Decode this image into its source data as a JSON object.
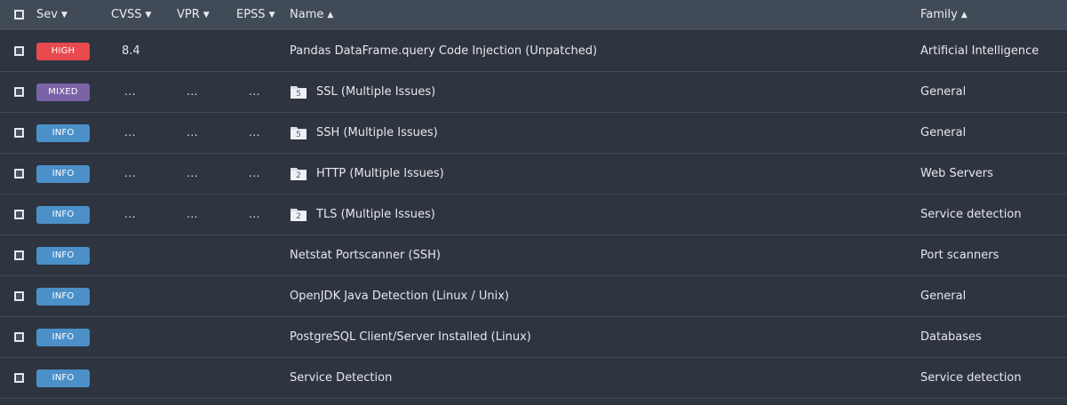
{
  "colors": {
    "high": "#e84a4f",
    "mixed": "#7a63a6",
    "info": "#4b90c9",
    "header_bg": "#414b58",
    "row_bg": "#2e3440"
  },
  "header": {
    "sev": "Sev",
    "cvss": "CVSS",
    "vpr": "VPR",
    "epss": "EPSS",
    "name": "Name",
    "family": "Family",
    "sort_down_icon": "caret-down-icon",
    "sort_up_icon": "caret-up-icon"
  },
  "rows": [
    {
      "severity": "HIGH",
      "sev_color": "high",
      "cvss": "8.4",
      "vpr": "",
      "epss": "",
      "has_folder": false,
      "count": "",
      "name": "Pandas DataFrame.query Code Injection (Unpatched)",
      "family": "Artificial Intelligence"
    },
    {
      "severity": "MIXED",
      "sev_color": "mixed",
      "cvss": "...",
      "vpr": "...",
      "epss": "...",
      "has_folder": true,
      "count": "5",
      "name": "SSL (Multiple Issues)",
      "family": "General"
    },
    {
      "severity": "INFO",
      "sev_color": "info",
      "cvss": "...",
      "vpr": "...",
      "epss": "...",
      "has_folder": true,
      "count": "5",
      "name": "SSH (Multiple Issues)",
      "family": "General"
    },
    {
      "severity": "INFO",
      "sev_color": "info",
      "cvss": "...",
      "vpr": "...",
      "epss": "...",
      "has_folder": true,
      "count": "2",
      "name": "HTTP (Multiple Issues)",
      "family": "Web Servers"
    },
    {
      "severity": "INFO",
      "sev_color": "info",
      "cvss": "...",
      "vpr": "...",
      "epss": "...",
      "has_folder": true,
      "count": "2",
      "name": "TLS (Multiple Issues)",
      "family": "Service detection"
    },
    {
      "severity": "INFO",
      "sev_color": "info",
      "cvss": "",
      "vpr": "",
      "epss": "",
      "has_folder": false,
      "count": "",
      "name": "Netstat Portscanner (SSH)",
      "family": "Port scanners"
    },
    {
      "severity": "INFO",
      "sev_color": "info",
      "cvss": "",
      "vpr": "",
      "epss": "",
      "has_folder": false,
      "count": "",
      "name": "OpenJDK Java Detection (Linux / Unix)",
      "family": "General"
    },
    {
      "severity": "INFO",
      "sev_color": "info",
      "cvss": "",
      "vpr": "",
      "epss": "",
      "has_folder": false,
      "count": "",
      "name": "PostgreSQL Client/Server Installed (Linux)",
      "family": "Databases"
    },
    {
      "severity": "INFO",
      "sev_color": "info",
      "cvss": "",
      "vpr": "",
      "epss": "",
      "has_folder": false,
      "count": "",
      "name": "Service Detection",
      "family": "Service detection"
    }
  ]
}
